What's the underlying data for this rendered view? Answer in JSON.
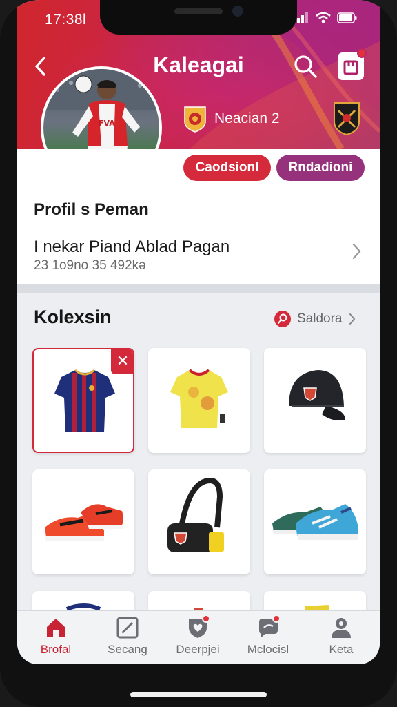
{
  "status_bar": {
    "time": "17:38l"
  },
  "header": {
    "title": "Kaleagai",
    "team_name": "Neacian 2",
    "chips": [
      "Caodsionl",
      "Rndadioni"
    ]
  },
  "profile": {
    "heading": "Profil s Peman",
    "detail_name": "I nekar Piand Ablad Pagan",
    "detail_meta": "23 1o9no 35 492kə"
  },
  "collection": {
    "title": "Kolexsin",
    "link_label": "Saldora",
    "items": [
      "striped-jersey",
      "yellow-jersey",
      "black-cap",
      "orange-sneakers",
      "black-shoulder-bag",
      "teal-sneakers"
    ]
  },
  "tabs": [
    {
      "label": "Brofal",
      "icon": "home-icon",
      "active": true
    },
    {
      "label": "Secang",
      "icon": "edit-square-icon",
      "active": false
    },
    {
      "label": "Deerpjei",
      "icon": "shield-heart-icon",
      "active": false
    },
    {
      "label": "Mclocisl",
      "icon": "chat-icon",
      "active": false
    },
    {
      "label": "Keta",
      "icon": "person-icon",
      "active": false
    }
  ],
  "colors": {
    "brand_red": "#d52a3c",
    "brand_purple": "#96317c",
    "active_tab": "#c82335"
  }
}
